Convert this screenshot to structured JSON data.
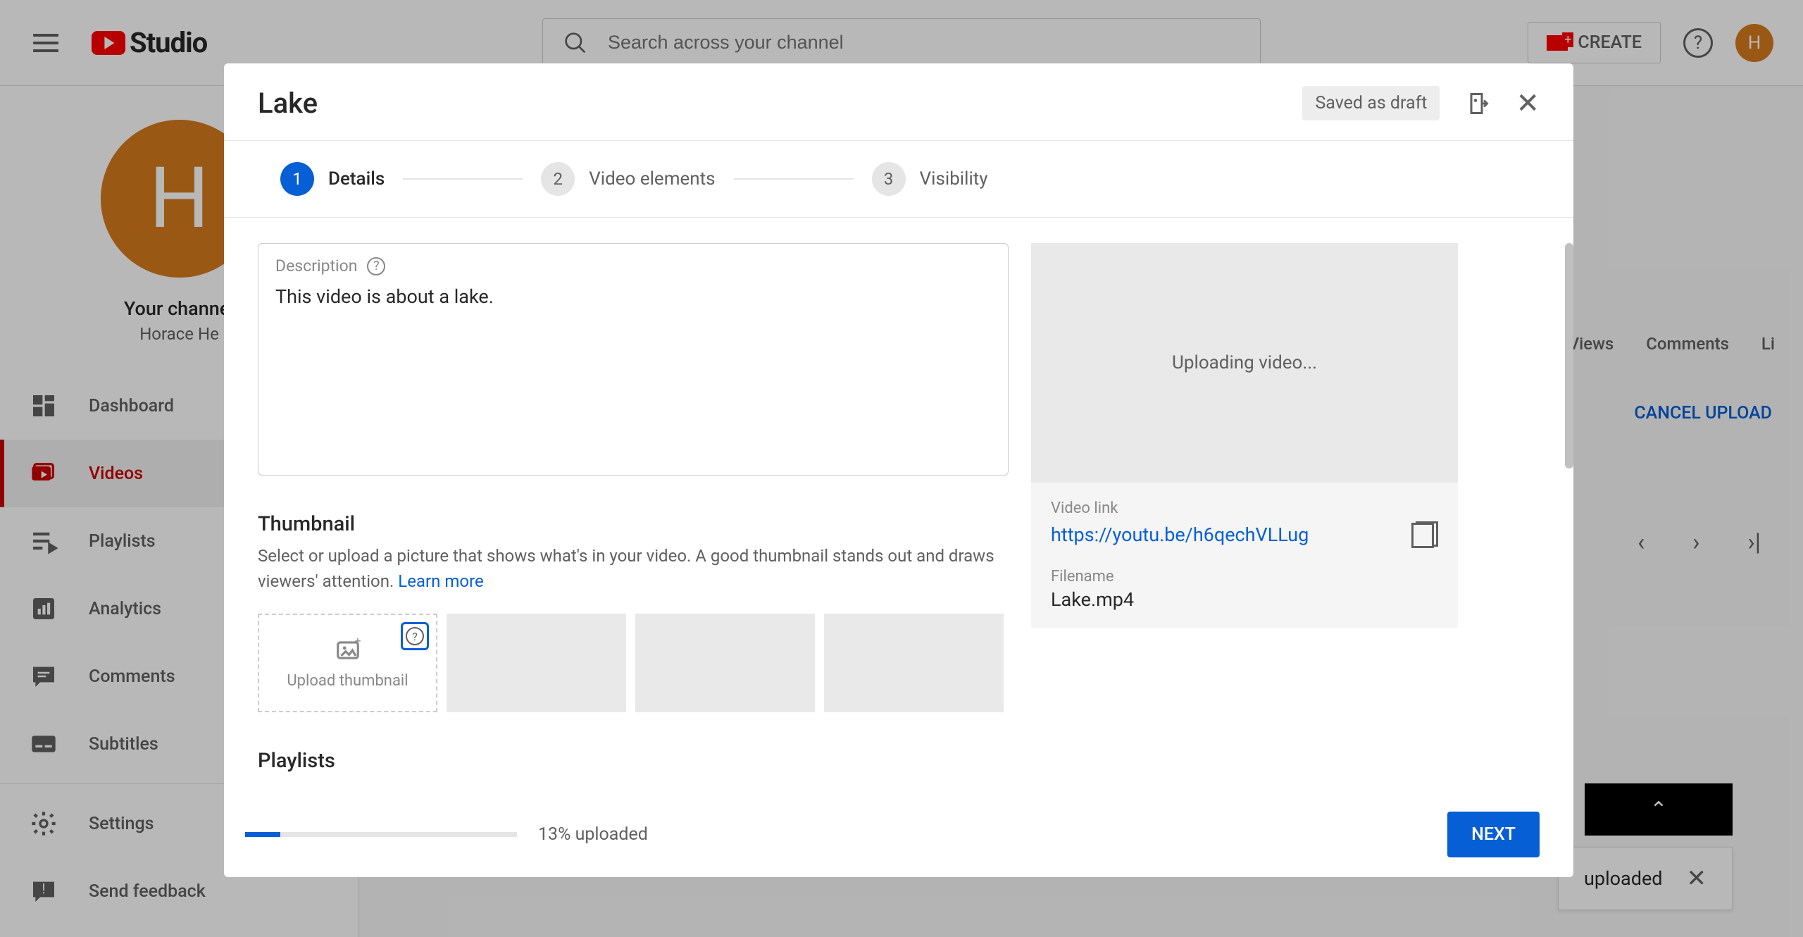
{
  "header": {
    "logo_text": "Studio",
    "search_placeholder": "Search across your channel",
    "create_label": "CREATE",
    "avatar_initial": "H"
  },
  "sidebar": {
    "avatar_initial": "H",
    "channel_label": "Your channel",
    "channel_name": "Horace He",
    "items": [
      {
        "label": "Dashboard"
      },
      {
        "label": "Videos"
      },
      {
        "label": "Playlists"
      },
      {
        "label": "Analytics"
      },
      {
        "label": "Comments"
      },
      {
        "label": "Subtitles"
      }
    ],
    "bottom": [
      {
        "label": "Settings"
      },
      {
        "label": "Send feedback"
      }
    ]
  },
  "bg": {
    "table_headers": [
      "Views",
      "Comments",
      "Li"
    ],
    "cancel_label": "CANCEL UPLOAD",
    "toast_text": "uploaded"
  },
  "modal": {
    "title": "Lake",
    "draft_label": "Saved as draft",
    "steps": [
      {
        "num": "1",
        "label": "Details"
      },
      {
        "num": "2",
        "label": "Video elements"
      },
      {
        "num": "3",
        "label": "Visibility"
      }
    ],
    "description": {
      "label": "Description",
      "value": "This video is about a lake."
    },
    "thumbnail": {
      "title": "Thumbnail",
      "desc_a": "Select or upload a picture that shows what's in your video. A good thumbnail stands out and draws viewers' attention. ",
      "learn_more": "Learn more",
      "upload_label": "Upload thumbnail"
    },
    "playlists_title": "Playlists",
    "preview": {
      "status": "Uploading video...",
      "link_label": "Video link",
      "link_url": "https://youtu.be/h6qechVLLug",
      "filename_label": "Filename",
      "filename": "Lake.mp4"
    },
    "footer": {
      "progress_pct": 13,
      "progress_text": "13% uploaded",
      "next_label": "NEXT"
    }
  }
}
